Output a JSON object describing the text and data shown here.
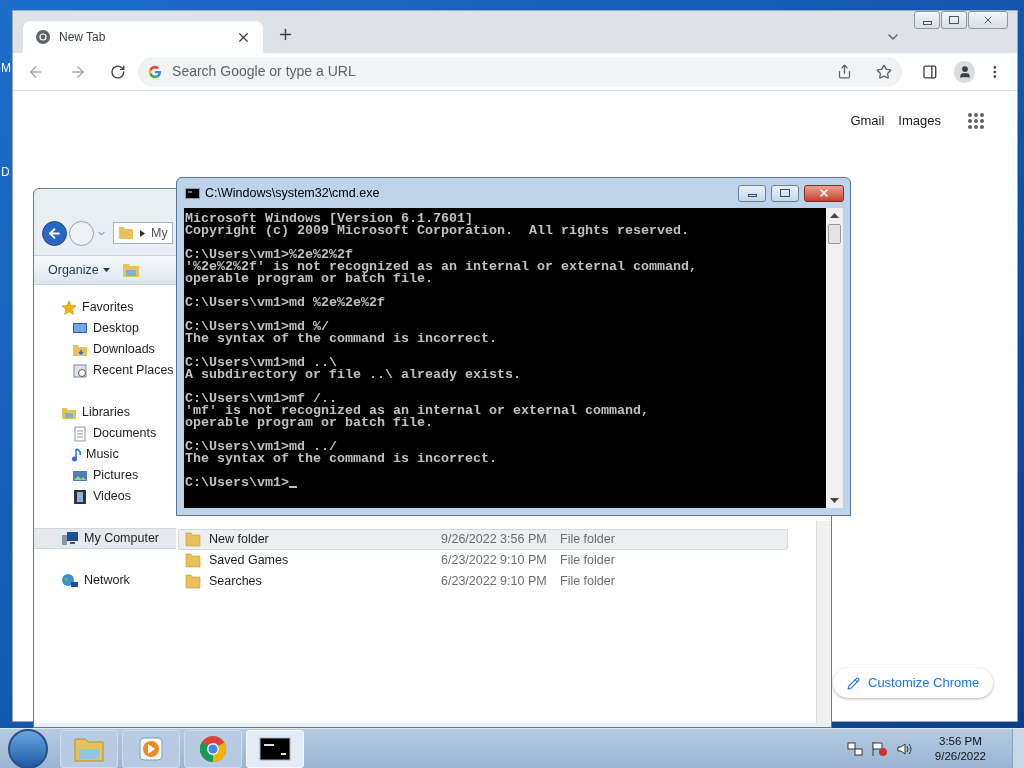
{
  "desktop": {
    "icon_labels": [
      "M",
      "D"
    ]
  },
  "chrome": {
    "tab": {
      "title": "New Tab"
    },
    "omnibox": {
      "placeholder": "Search Google or type a URL"
    },
    "header_links": [
      "Gmail",
      "Images"
    ],
    "customize_button": "Customize Chrome"
  },
  "explorer": {
    "address": "My",
    "toolbar": [
      "Organize"
    ],
    "sidebar": [
      {
        "label": "Favorites",
        "kind": "star",
        "selected": false,
        "children": [
          {
            "label": "Desktop",
            "kind": "desktop",
            "selected": false
          },
          {
            "label": "Downloads",
            "kind": "downloads",
            "selected": false
          },
          {
            "label": "Recent Places",
            "kind": "recent",
            "selected": false
          }
        ]
      },
      {
        "label": "Libraries",
        "kind": "library",
        "selected": false,
        "children": [
          {
            "label": "Documents",
            "kind": "document",
            "selected": false
          },
          {
            "label": "Music",
            "kind": "music",
            "selected": false
          },
          {
            "label": "Pictures",
            "kind": "pictures",
            "selected": false
          },
          {
            "label": "Videos",
            "kind": "videos",
            "selected": false
          }
        ]
      },
      {
        "label": "My Computer",
        "kind": "computer",
        "selected": true
      },
      {
        "label": "Network",
        "kind": "network",
        "selected": false
      }
    ],
    "files": [
      {
        "name": "New folder",
        "date": "9/26/2022 3:56 PM",
        "type": "File folder",
        "selected": true
      },
      {
        "name": "Saved Games",
        "date": "6/23/2022 9:10 PM",
        "type": "File folder",
        "selected": false
      },
      {
        "name": "Searches",
        "date": "6/23/2022 9:10 PM",
        "type": "File folder",
        "selected": false
      }
    ]
  },
  "cmd": {
    "title": "C:\\Windows\\system32\\cmd.exe",
    "blocks": [
      [
        "Microsoft Windows [Version 6.1.7601]",
        "Copyright (c) 2009 Microsoft Corporation.  All rights reserved."
      ],
      [
        "C:\\Users\\vm1>%2e%2%2f",
        "'%2e%2%2f' is not recognized as an internal or external command,",
        "operable program or batch file."
      ],
      [
        "C:\\Users\\vm1>md %2e%2e%2f"
      ],
      [
        "C:\\Users\\vm1>md %/",
        "The syntax of the command is incorrect."
      ],
      [
        "C:\\Users\\vm1>md ..\\",
        "A subdirectory or file ..\\ already exists."
      ],
      [
        "C:\\Users\\vm1>mf /..",
        "'mf' is not recognized as an internal or external command,",
        "operable program or batch file."
      ],
      [
        "C:\\Users\\vm1>md ../",
        "The syntax of the command is incorrect."
      ]
    ],
    "prompt": "C:\\Users\\vm1>"
  },
  "taskbar": {
    "apps": [
      {
        "kind": "explorer",
        "selected": false
      },
      {
        "kind": "media",
        "selected": false
      },
      {
        "kind": "chrome",
        "selected": false
      },
      {
        "kind": "cmd",
        "selected": true
      }
    ],
    "time": "3:56 PM",
    "date": "9/26/2022"
  }
}
